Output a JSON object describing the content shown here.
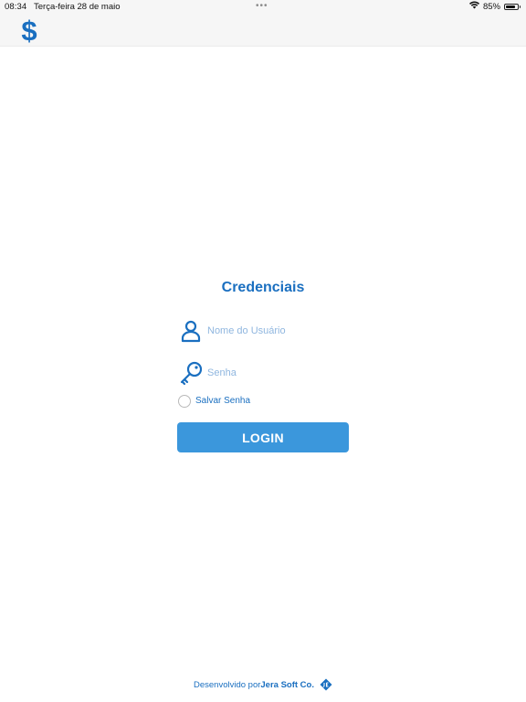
{
  "status_bar": {
    "time": "08:34",
    "date": "Terça-feira 28 de maio",
    "multitask_dots": "•••",
    "battery_text": "85%",
    "battery_level": 0.85,
    "wifi_icon": "wifi-icon",
    "battery_icon": "battery-icon"
  },
  "nav_bar": {
    "logo_icon": "dollar-sign-icon"
  },
  "login": {
    "title": "Credenciais",
    "username": {
      "icon": "user-icon",
      "placeholder": "Nome do Usuário",
      "value": ""
    },
    "password": {
      "icon": "key-icon",
      "placeholder": "Senha",
      "value": ""
    },
    "remember": {
      "label": "Salvar Senha",
      "checked": false
    },
    "button_label": "LOGIN"
  },
  "footer": {
    "prefix": "Desenvolvido por",
    "company": "Jera Soft Co.",
    "logo_icon": "jera-logo-icon"
  },
  "colors": {
    "accent": "#1a6fc0",
    "button": "#3b97dc",
    "placeholder": "#8fb6df",
    "bar_background": "#f6f6f6"
  }
}
